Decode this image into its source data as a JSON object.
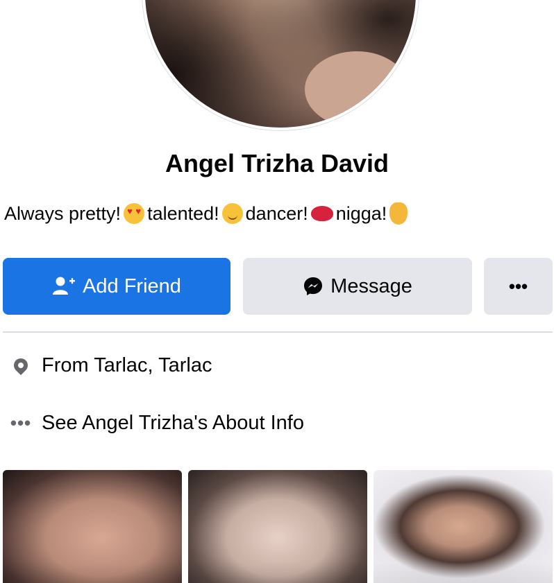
{
  "profile": {
    "name": "Angel Trizha David",
    "bio": [
      {
        "text": "Always pretty!",
        "emoji": "heart-eyes-emoji"
      },
      {
        "text": " talented!",
        "emoji": "blushing-smile-emoji"
      },
      {
        "text": " dancer!",
        "emoji": "kiss-mark-emoji"
      },
      {
        "text": " nigga!",
        "emoji": "ok-hand-emoji"
      }
    ]
  },
  "actions": {
    "add_friend": "Add Friend",
    "message": "Message",
    "more": "•••"
  },
  "icons": {
    "add_friend": "add-friend-icon",
    "message": "messenger-icon",
    "location": "location-pin-icon",
    "about": "more-dots-icon"
  },
  "details": {
    "from": "From Tarlac, Tarlac",
    "about": "See Angel Trizha's About Info",
    "about_icon_text": "•••"
  },
  "colors": {
    "primary_button": "#1b74e4",
    "secondary_button": "#e4e6eb",
    "icon_gray": "#65676b"
  }
}
